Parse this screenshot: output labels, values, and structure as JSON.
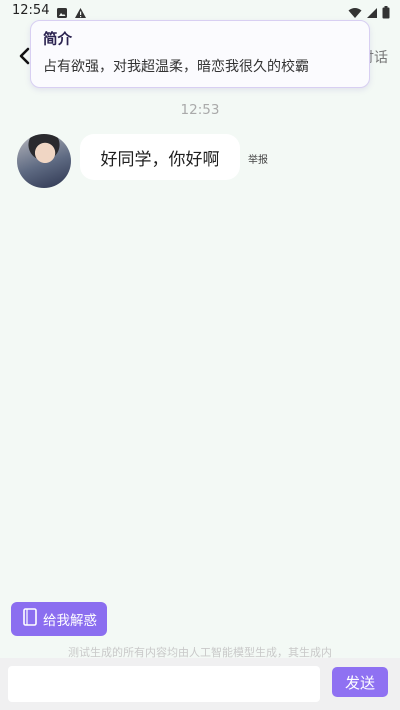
{
  "status_bar": {
    "time": "12:54",
    "icons_left": [
      "photo-icon",
      "warning-icon"
    ],
    "icons_right": [
      "wifi-icon",
      "signal-icon",
      "battery-icon"
    ]
  },
  "header": {
    "right_partial_label": "讨话"
  },
  "intro": {
    "title": "简介",
    "text": "占有欲强，对我超温柔，暗恋我很久的校霸"
  },
  "chat": {
    "timestamp": "12:53",
    "messages": [
      {
        "text": "好同学，你好啊",
        "report_label": "举报"
      }
    ]
  },
  "actions": {
    "solve_button_label": "给我解惑"
  },
  "disclaimer": "测试生成的所有内容均由人工智能模型生成，其生成内",
  "composer": {
    "input_value": "",
    "input_placeholder": "",
    "send_label": "发送"
  },
  "colors": {
    "background": "#f3f9f5",
    "accent": "#8b6ef0",
    "popup_border": "#d8cff2"
  }
}
